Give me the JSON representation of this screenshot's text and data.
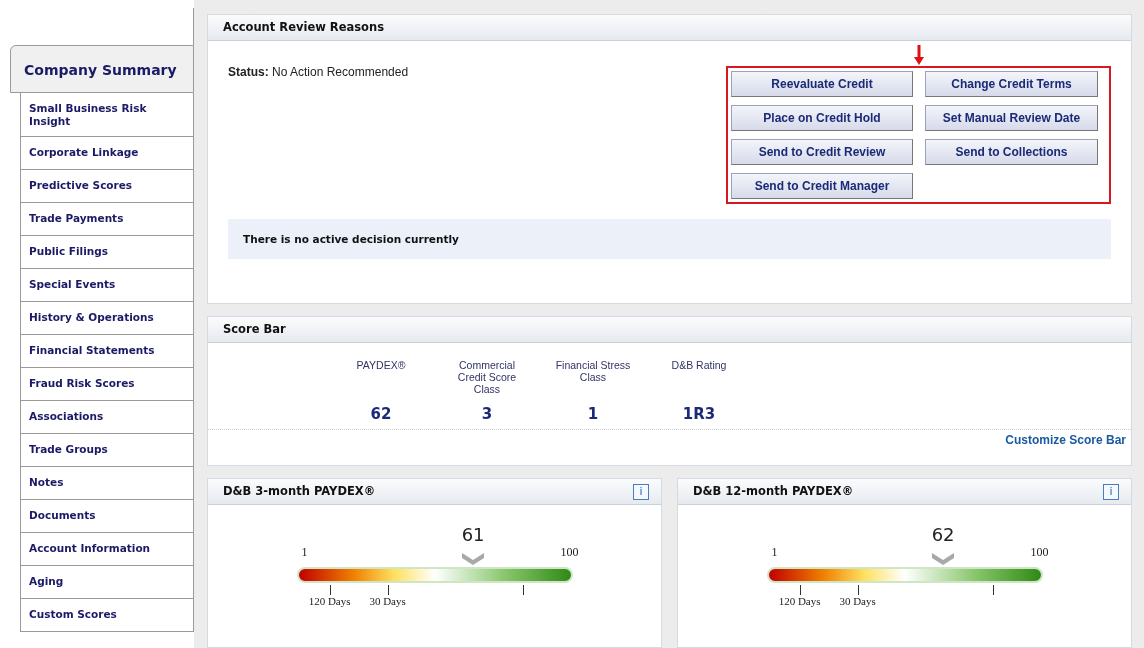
{
  "sidebar": {
    "tabs": [
      {
        "label": "Company Summary",
        "selected": true
      },
      {
        "label": "Small Business Risk Insight",
        "selected": false
      },
      {
        "label": "Corporate Linkage",
        "selected": false
      },
      {
        "label": "Predictive Scores",
        "selected": false
      },
      {
        "label": "Trade Payments",
        "selected": false
      },
      {
        "label": "Public Filings",
        "selected": false
      },
      {
        "label": "Special Events",
        "selected": false
      },
      {
        "label": "History & Operations",
        "selected": false
      },
      {
        "label": "Financial Statements",
        "selected": false
      },
      {
        "label": "Fraud Risk Scores",
        "selected": false
      },
      {
        "label": "Associations",
        "selected": false
      },
      {
        "label": "Trade Groups",
        "selected": false
      },
      {
        "label": "Notes",
        "selected": false
      },
      {
        "label": "Documents",
        "selected": false
      },
      {
        "label": "Account Information",
        "selected": false
      },
      {
        "label": "Aging",
        "selected": false
      },
      {
        "label": "Custom Scores",
        "selected": false
      }
    ]
  },
  "account_review": {
    "title": "Account Review Reasons",
    "status_label": "Status:",
    "status": "No Action Recommended",
    "buttons": [
      "Reevaluate Credit",
      "Change Credit Terms",
      "Place on Credit Hold",
      "Set Manual Review Date",
      "Send to Credit Review",
      "Send to Collections",
      "Send to Credit Manager"
    ],
    "notice": "There is no active decision currently"
  },
  "score_bar": {
    "title": "Score Bar",
    "scores": [
      {
        "label": "PAYDEX®",
        "value": "62"
      },
      {
        "label": "Commercial Credit Score Class",
        "value": "3"
      },
      {
        "label": "Financial Stress Class",
        "value": "1"
      },
      {
        "label": "D&B Rating",
        "value": "1R3"
      }
    ],
    "link": "Customize Score Bar"
  },
  "gauges": [
    {
      "title": "D&B 3-month PAYDEX®",
      "info": "i",
      "value": "61",
      "min": "1",
      "max": "100",
      "ticks": [
        "120 Days",
        "30 Days"
      ]
    },
    {
      "title": "D&B 12-month PAYDEX®",
      "info": "i",
      "value": "62",
      "min": "1",
      "max": "100",
      "ticks": [
        "120 Days",
        "30 Days"
      ]
    }
  ]
}
